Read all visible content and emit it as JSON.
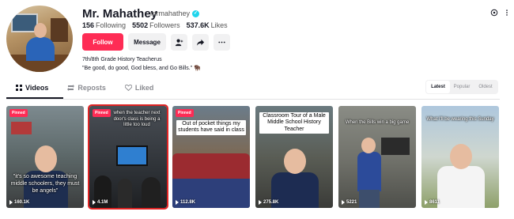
{
  "profile": {
    "name": "Mr. Mahathey",
    "handle": "mrmahathey",
    "stats": [
      {
        "value": "156",
        "label": "Following"
      },
      {
        "value": "5502",
        "label": "Followers"
      },
      {
        "value": "537.6K",
        "label": "Likes"
      }
    ],
    "bio_line1": "7th/8th Grade History Teacherus",
    "bio_line2": "\"Be good, do good, God bless, and Go Bills.\" 🦬"
  },
  "actions": {
    "follow_label": "Follow",
    "message_label": "Message",
    "icons": [
      "add-friend-icon",
      "share-icon",
      "more-icon"
    ]
  },
  "top_icons": [
    "settings-icon",
    "more-icon"
  ],
  "tabs": [
    {
      "label": "Videos",
      "icon": "grid-icon",
      "active": true
    },
    {
      "label": "Reposts",
      "icon": "repost-icon",
      "active": false
    },
    {
      "label": "Liked",
      "icon": "heart-icon",
      "active": false
    }
  ],
  "sort": {
    "options": [
      "Latest",
      "Popular",
      "Oldest"
    ],
    "selected": "Latest"
  },
  "colors": {
    "accent": "#fe2c55",
    "verified": "#20d5ec",
    "selection": "#e02424"
  },
  "videos": [
    {
      "pinned_label": "Pinned",
      "caption": "\"it's so awesome teaching middle schoolers, they must be angels\"",
      "views": "160.1K"
    },
    {
      "pinned_label": "Pinned",
      "caption": "when the teacher next door's class is being a little too loud",
      "views": "4.1M"
    },
    {
      "pinned_label": "Pinned",
      "caption": "Out of pocket things my students have said in class",
      "views": "112.8K"
    },
    {
      "pinned_label": "",
      "caption": "Classroom Tour of a Male Middle School History Teacher",
      "views": "275.8K"
    },
    {
      "pinned_label": "",
      "caption": "When the Bills win a big game",
      "views": "5221"
    },
    {
      "pinned_label": "",
      "caption": "What I'll be wearing this Sunday",
      "views": "8611"
    }
  ]
}
